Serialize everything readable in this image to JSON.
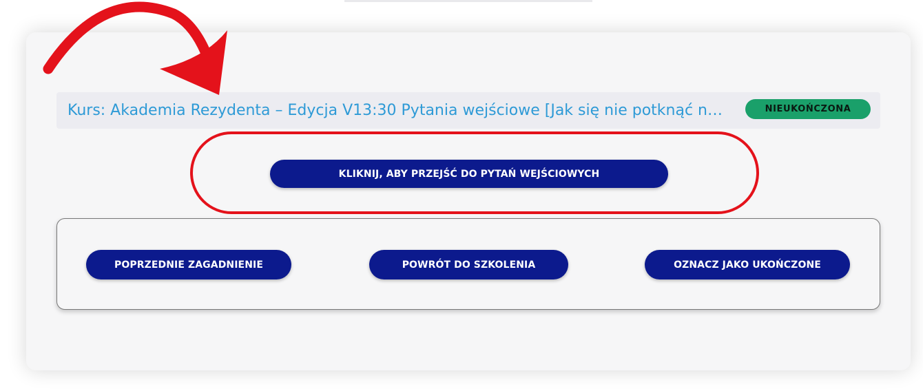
{
  "lesson": {
    "breadcrumb": "Kurs: Akademia Rezydenta – Edycja V13:30 Pytania wejściowe [Jak się nie potknąć n…",
    "status_badge": "NIEUKOŃCZONA",
    "go_to_questions_label": "KLIKNIJ, ABY PRZEJŚĆ DO PYTAŃ WEJŚCIOWYCH"
  },
  "navigation": {
    "previous_label": "POPRZEDNIE ZAGADNIENIE",
    "back_label": "POWRÓT DO SZKOLENIA",
    "mark_complete_label": "OZNACZ JAKO UKOŃCZONE"
  },
  "annotations": {
    "arrow_icon": "curved-arrow-icon",
    "highlight_color": "#e4121b"
  },
  "colors": {
    "button_bg": "#0c1a8d",
    "breadcrumb_link": "#2e9ad6",
    "badge_bg": "#1aa06a"
  }
}
